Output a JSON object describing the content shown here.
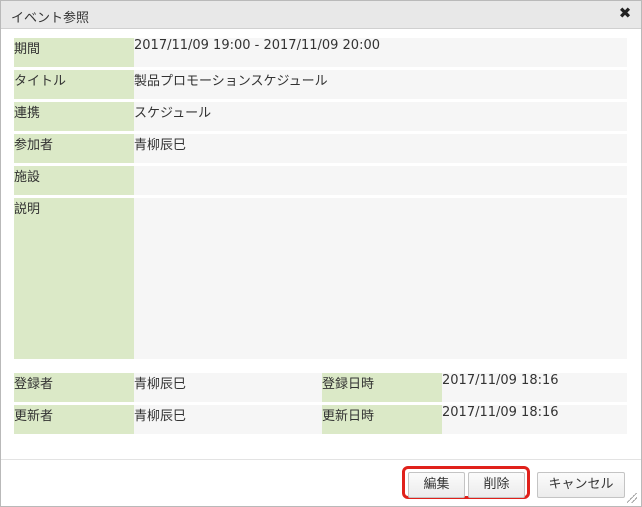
{
  "dialog": {
    "title": "イベント参照",
    "close_icon": "close-icon"
  },
  "fields": [
    {
      "label": "期間",
      "value": "2017/11/09 19:00 - 2017/11/09 20:00"
    },
    {
      "label": "タイトル",
      "value": "製品プロモーションスケジュール"
    },
    {
      "label": "連携",
      "value": "スケジュール"
    },
    {
      "label": "参加者",
      "value": "青柳辰巳"
    },
    {
      "label": "施設",
      "value": ""
    },
    {
      "label": "説明",
      "value": ""
    }
  ],
  "meta": {
    "registrant_label": "登録者",
    "registrant_value": "青柳辰巳",
    "registered_at_label": "登録日時",
    "registered_at_value": "2017/11/09 18:16",
    "updater_label": "更新者",
    "updater_value": "青柳辰巳",
    "updated_at_label": "更新日時",
    "updated_at_value": "2017/11/09 18:16"
  },
  "buttons": {
    "edit": "編集",
    "delete": "削除",
    "cancel": "キャンセル"
  },
  "colors": {
    "label_bg": "#dbe9c7",
    "value_bg": "#f6f6f6",
    "highlight": "#e0211b"
  }
}
